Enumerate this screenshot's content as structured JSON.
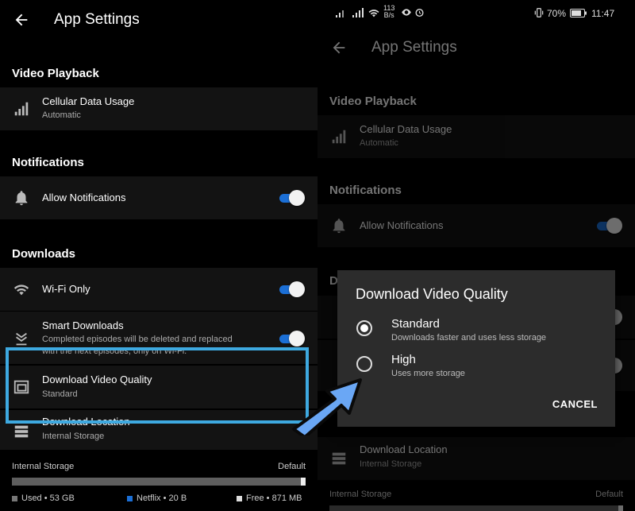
{
  "left": {
    "title": "App Settings",
    "sections": {
      "video_playback": "Video Playback",
      "notifications": "Notifications",
      "downloads": "Downloads"
    },
    "rows": {
      "cellular_title": "Cellular Data Usage",
      "cellular_sub": "Automatic",
      "notif_title": "Allow Notifications",
      "wifi_title": "Wi-Fi Only",
      "smart_title": "Smart Downloads",
      "smart_sub1": "Completed episodes will be deleted and replaced",
      "smart_sub2": "with the next episodes, only on Wi-Fi.",
      "quality_title": "Download Video Quality",
      "quality_sub": "Standard",
      "location_title": "Download Location",
      "location_sub": "Internal Storage"
    },
    "storage": {
      "label": "Internal Storage",
      "default_label": "Default",
      "used": "Used • 53 GB",
      "netflix": "Netflix • 20 B",
      "free": "Free • 871 MB"
    }
  },
  "right": {
    "status": {
      "speed_top": "113",
      "speed_unit": "B/s",
      "battery": "70%",
      "time": "11:47"
    },
    "title": "App Settings",
    "sections": {
      "video_playback": "Video Playback",
      "notifications": "Notifications",
      "downloads": "D"
    },
    "rows": {
      "cellular_title": "Cellular Data Usage",
      "cellular_sub": "Automatic",
      "notif_title": "Allow Notifications",
      "location_title": "Download Location",
      "location_sub": "Internal Storage"
    },
    "storage": {
      "label": "Internal Storage",
      "default_label": "Default"
    },
    "dialog": {
      "title": "Download Video Quality",
      "options": [
        {
          "title": "Standard",
          "sub": "Downloads faster and uses less storage",
          "selected": true
        },
        {
          "title": "High",
          "sub": "Uses more storage",
          "selected": false
        }
      ],
      "cancel": "CANCEL"
    }
  },
  "colors": {
    "toggle_on": "#1b6fd6",
    "highlight": "#3ea9e0",
    "arrow": "#6aa7f5",
    "netflix_legend": "#1b6fd6"
  },
  "storage_fraction": {
    "used": 0.985
  }
}
